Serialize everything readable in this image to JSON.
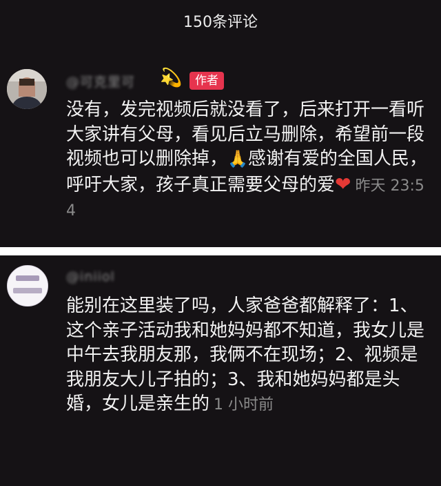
{
  "header": {
    "title": "150条评论"
  },
  "comments": [
    {
      "username": "@可克里可",
      "emoji": "💫",
      "badge": "作者",
      "text": "没有，发完视频后就没看了，后来打开一看听大家讲有父母，看见后立马删除，希望前一段视频也可以删除掉，",
      "text_after_emoji": "感谢有爱的全国人民，呼吁大家，孩子真正需要父母的爱",
      "pray_emoji": "🙏",
      "heart_emoji": "❤",
      "time": "昨天 23:54"
    },
    {
      "username": "@iniiol",
      "text": "能别在这里装了吗，人家爸爸都解释了：1、这个亲子活动我和她妈妈都不知道，我女儿是中午去我朋友那，我俩不在现场；2、视频是我朋友大儿子拍的；3、我和她妈妈都是头婚，女儿是亲生的",
      "time": "1 小时前"
    }
  ],
  "colors": {
    "background": "#151215",
    "badge": "#e6344e",
    "text": "#f2f2f2",
    "meta": "#8b8b8b"
  },
  "icons": [
    "dizzy-emoji-icon",
    "pray-emoji-icon",
    "heart-emoji-icon"
  ]
}
